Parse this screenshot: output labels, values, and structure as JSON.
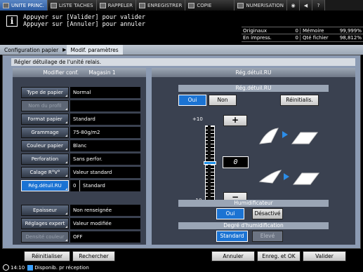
{
  "tabs": [
    {
      "label": "UNITE PRINC.",
      "icon": "home-icon"
    },
    {
      "label": "LISTE TACHES",
      "icon": "job-list-icon"
    },
    {
      "label": "RAPPELER",
      "icon": "recall-icon"
    },
    {
      "label": "ENREGISTRER",
      "icon": "store-icon"
    },
    {
      "label": "COPIE",
      "icon": "copy-icon"
    },
    {
      "label": "NUMERISATION",
      "icon": "scan-icon"
    }
  ],
  "message": {
    "line1": "Appuyer sur [Valider] pour valider",
    "line2": "Appuyer sur [Annuler] pour annuler"
  },
  "status": {
    "originaux_label": "Originaux",
    "originaux_value": "0",
    "memoire_label": "Mémoire",
    "memoire_value": "99,999%",
    "en_impress_label": "En impress.",
    "en_impress_value": "0",
    "qte_fichier_label": "Qté fichier",
    "qte_fichier_value": "98,812%"
  },
  "breadcrumb": {
    "item1": "Configuration papier",
    "item2": "Modif. paramètres"
  },
  "heading": "Régler détuilage de l'unité relais.",
  "left": {
    "header_left": "Modifier conf.",
    "header_right": "Magasin 1",
    "rows": [
      {
        "label": "Type de papier",
        "value": "Normal"
      },
      {
        "label": "Nom du profil",
        "value": ""
      },
      {
        "label": "Format papier",
        "value": "Standard"
      },
      {
        "label": "Grammage",
        "value": "75-80g/m2"
      },
      {
        "label": "Couleur papier",
        "value": "Blanc"
      },
      {
        "label": "Perforation",
        "value": "Sans perfor."
      },
      {
        "label": "Calage R°V°",
        "value": "Valeur standard"
      },
      {
        "label": "Rég.détuil.RU",
        "value_a": "0",
        "value_b": "Standard"
      },
      {
        "label": "Epaisseur",
        "value": "Non renseignée"
      },
      {
        "label": "Réglages expert",
        "value": "Valeur modifiée"
      },
      {
        "label": "Densité couleur",
        "value": "OFF"
      }
    ]
  },
  "right": {
    "title": "Rég.détuil.RU",
    "subtitle": "Rég.détuil.RU",
    "on_label": "Oui",
    "off_label": "Non",
    "reset_label": "Réinitialis.",
    "scale_max": "+10",
    "scale_min": "-10",
    "plus_label": "+",
    "minus_label": "−",
    "value": "0",
    "humidif_title": "Humidificateur",
    "humidif_on": "Oui",
    "humidif_off": "Désactivé",
    "degree_title": "Degré d'humidification",
    "degree_standard": "Standard",
    "degree_high": "Elevé"
  },
  "bottom": {
    "reset": "Réinitialiser",
    "search": "Rechercher",
    "cancel": "Annuler",
    "save_ok": "Enreg. et OK",
    "validate": "Valider"
  },
  "footer": {
    "time": "14:10",
    "status_text": "Disponib. pr réception"
  },
  "colors": {
    "accent": "#1b73d3",
    "panel_bg": "#3a4150",
    "main_bg": "#8c9bb3"
  }
}
